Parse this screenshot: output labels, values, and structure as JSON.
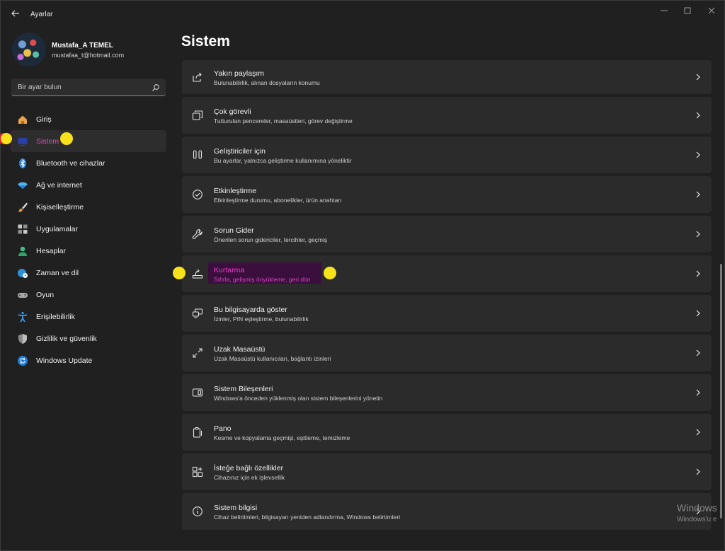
{
  "window": {
    "title": "Ayarlar"
  },
  "profile": {
    "name": "Mustafa_A TEMEL",
    "email": "mustafaa_t@hotmail.com"
  },
  "search": {
    "placeholder": "Bir ayar bulun"
  },
  "sidebar": {
    "items": [
      {
        "label": "Giriş",
        "icon": "home-icon",
        "active": false
      },
      {
        "label": "Sistem",
        "icon": "system-icon",
        "active": true
      },
      {
        "label": "Bluetooth ve cihazlar",
        "icon": "bluetooth-icon",
        "active": false
      },
      {
        "label": "Ağ ve internet",
        "icon": "wifi-icon",
        "active": false
      },
      {
        "label": "Kişiselleştirme",
        "icon": "brush-icon",
        "active": false
      },
      {
        "label": "Uygulamalar",
        "icon": "apps-icon",
        "active": false
      },
      {
        "label": "Hesaplar",
        "icon": "person-icon",
        "active": false
      },
      {
        "label": "Zaman ve dil",
        "icon": "clock-globe-icon",
        "active": false
      },
      {
        "label": "Oyun",
        "icon": "gamepad-icon",
        "active": false
      },
      {
        "label": "Erişilebilirlik",
        "icon": "accessibility-icon",
        "active": false
      },
      {
        "label": "Gizlilik ve güvenlik",
        "icon": "shield-icon",
        "active": false
      },
      {
        "label": "Windows Update",
        "icon": "update-icon",
        "active": false
      }
    ]
  },
  "main": {
    "title": "Sistem",
    "cards": [
      {
        "title": "Yakın paylaşım",
        "desc": "Bulunabilirlik, alınan dosyaların konumu",
        "icon": "share-icon"
      },
      {
        "title": "Çok görevli",
        "desc": "Tutturulan pencereler, masaüstleri, görev değiştirme",
        "icon": "multitask-icon"
      },
      {
        "title": "Geliştiriciler için",
        "desc": "Bu ayarlar, yalnızca geliştirme kullanımına yöneliktir",
        "icon": "developer-icon"
      },
      {
        "title": "Etkinleştirme",
        "desc": "Etkinleştirme durumu, abonelikler, ürün anahtarı",
        "icon": "check-circle-icon"
      },
      {
        "title": "Sorun Gider",
        "desc": "Önerilen sorun gidericiler, tercihler, geçmiş",
        "icon": "wrench-icon"
      },
      {
        "title": "Kurtarma",
        "desc": "Sıfırla, gelişmiş önyükleme, geri dön",
        "icon": "recovery-icon",
        "highlighted": true
      },
      {
        "title": "Bu bilgisayarda göster",
        "desc": "İzinler, PIN eşleştirme, bulunabilirlik",
        "icon": "project-icon"
      },
      {
        "title": "Uzak Masaüstü",
        "desc": "Uzak Masaüstü kullanıcıları, bağlantı izinleri",
        "icon": "remote-icon"
      },
      {
        "title": "Sistem Bileşenleri",
        "desc": "Windows'a önceden yüklenmiş olan sistem bileşenlerini yönetin",
        "icon": "components-icon"
      },
      {
        "title": "Pano",
        "desc": "Kesme ve kopyalama geçmişi, eşitleme, temizleme",
        "icon": "clipboard-icon"
      },
      {
        "title": "İsteğe bağlı özellikler",
        "desc": "Cihazınız için ek işlevsellik",
        "icon": "optional-features-icon"
      },
      {
        "title": "Sistem bilgisi",
        "desc": "Cihaz belirtimleri, bilgisayarı yeniden adlandırma, Windows belirtimleri",
        "icon": "info-icon"
      }
    ]
  },
  "watermark": {
    "line1": "Windows",
    "line2": "Windows'u e"
  },
  "colors": {
    "accent": "#e844c8",
    "highlight": "#3a0f3d",
    "marker": "#f7e21b",
    "marker_red": "#d6203a",
    "card": "#2b2b2b"
  }
}
